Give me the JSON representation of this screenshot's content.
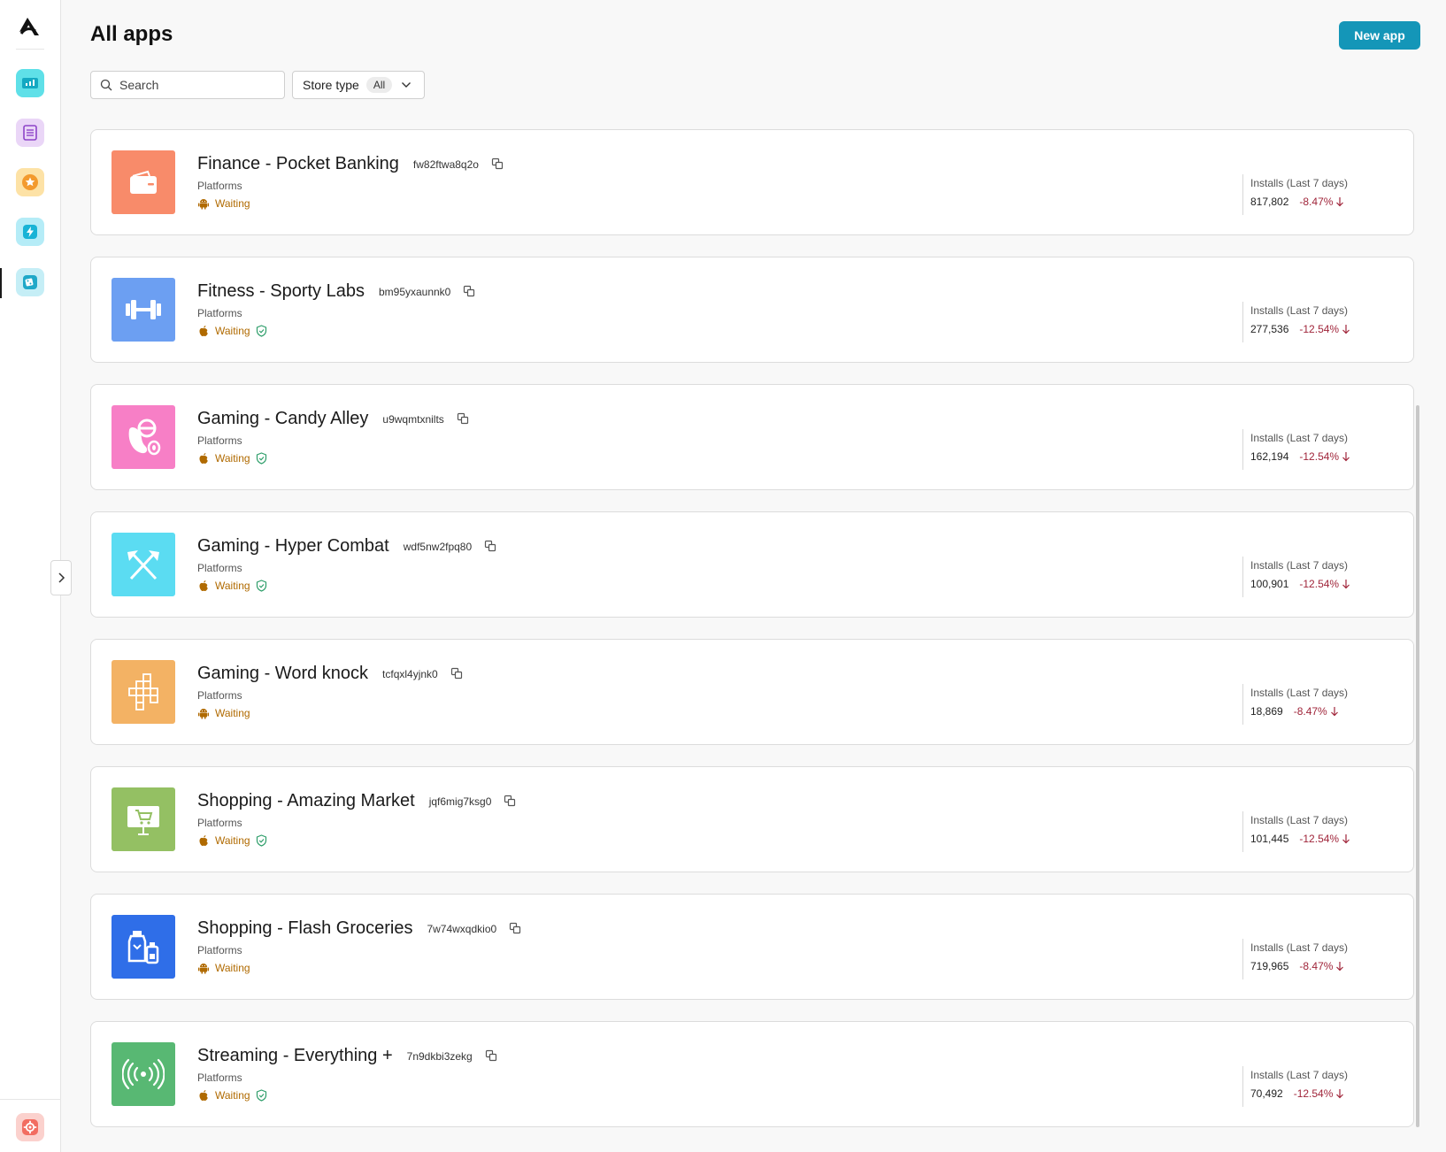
{
  "header": {
    "title": "All apps",
    "new_app_label": "New app"
  },
  "filters": {
    "search_placeholder": "Search",
    "store_type_label": "Store type",
    "store_type_value": "All"
  },
  "colors": {
    "accent": "#1496b8",
    "status_waiting": "#b06a00",
    "change_negative": "#a0253a",
    "verified": "#2e9e6a"
  },
  "apps": [
    {
      "name": "Finance - Pocket Banking",
      "id": "fw82ftwa8q2o",
      "platforms_label": "Platforms",
      "platform_icon": "android-icon",
      "status": "Waiting",
      "verified": false,
      "installs_label": "Installs (Last 7 days)",
      "installs": "817,802",
      "change": "-8.47%",
      "icon": "wallet-icon",
      "icon_color": "#f88b6a"
    },
    {
      "name": "Fitness - Sporty Labs",
      "id": "bm95yxaunnk0",
      "platforms_label": "Platforms",
      "platform_icon": "apple-icon",
      "status": "Waiting",
      "verified": true,
      "installs_label": "Installs (Last 7 days)",
      "installs": "277,536",
      "change": "-12.54%",
      "icon": "dumbbell-icon",
      "icon_color": "#6c9ff2"
    },
    {
      "name": "Gaming - Candy Alley",
      "id": "u9wqmtxnilts",
      "platforms_label": "Platforms",
      "platform_icon": "apple-icon",
      "status": "Waiting",
      "verified": true,
      "installs_label": "Installs (Last 7 days)",
      "installs": "162,194",
      "change": "-12.54%",
      "icon": "candy-icon",
      "icon_color": "#f77fc6"
    },
    {
      "name": "Gaming - Hyper Combat",
      "id": "wdf5nw2fpq80",
      "platforms_label": "Platforms",
      "platform_icon": "apple-icon",
      "status": "Waiting",
      "verified": true,
      "installs_label": "Installs (Last 7 days)",
      "installs": "100,901",
      "change": "-12.54%",
      "icon": "crossed-axes-icon",
      "icon_color": "#5bdcf2"
    },
    {
      "name": "Gaming - Word knock",
      "id": "tcfqxl4yjnk0",
      "platforms_label": "Platforms",
      "platform_icon": "android-icon",
      "status": "Waiting",
      "verified": false,
      "installs_label": "Installs (Last 7 days)",
      "installs": "18,869",
      "change": "-8.47%",
      "icon": "crossword-icon",
      "icon_color": "#f3b264"
    },
    {
      "name": "Shopping - Amazing Market",
      "id": "jqf6mig7ksg0",
      "platforms_label": "Platforms",
      "platform_icon": "apple-icon",
      "status": "Waiting",
      "verified": true,
      "installs_label": "Installs (Last 7 days)",
      "installs": "101,445",
      "change": "-12.54%",
      "icon": "shopping-cart-icon",
      "icon_color": "#94c063"
    },
    {
      "name": "Shopping - Flash Groceries",
      "id": "7w74wxqdkio0",
      "platforms_label": "Platforms",
      "platform_icon": "android-icon",
      "status": "Waiting",
      "verified": false,
      "installs_label": "Installs (Last 7 days)",
      "installs": "719,965",
      "change": "-8.47%",
      "icon": "groceries-icon",
      "icon_color": "#2f6ee8"
    },
    {
      "name": "Streaming - Everything +",
      "id": "7n9dkbi3zekg",
      "platforms_label": "Platforms",
      "platform_icon": "apple-icon",
      "status": "Waiting",
      "verified": true,
      "installs_label": "Installs (Last 7 days)",
      "installs": "70,492",
      "change": "-12.54%",
      "icon": "broadcast-icon",
      "icon_color": "#58b873"
    }
  ]
}
